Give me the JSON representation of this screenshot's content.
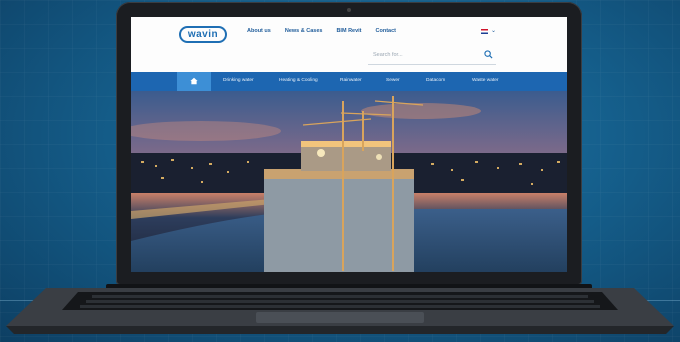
{
  "colors": {
    "brand_blue": "#1f6fb4",
    "menu_bar": "#1d66b1",
    "menu_active": "#3d8fd6",
    "background": "#155f8c"
  },
  "site": {
    "logo_text": "wavin",
    "nav": [
      "About us",
      "News & Cases",
      "BIM Revit",
      "Contact"
    ],
    "language_icon": "uk-flag-icon",
    "search_placeholder": "Search for...",
    "menu_home_icon": "home-icon",
    "menu": [
      "Drinking water",
      "Heating & Cooling",
      "Rainwater",
      "Sewer",
      "Datacom",
      "Waste water"
    ]
  }
}
